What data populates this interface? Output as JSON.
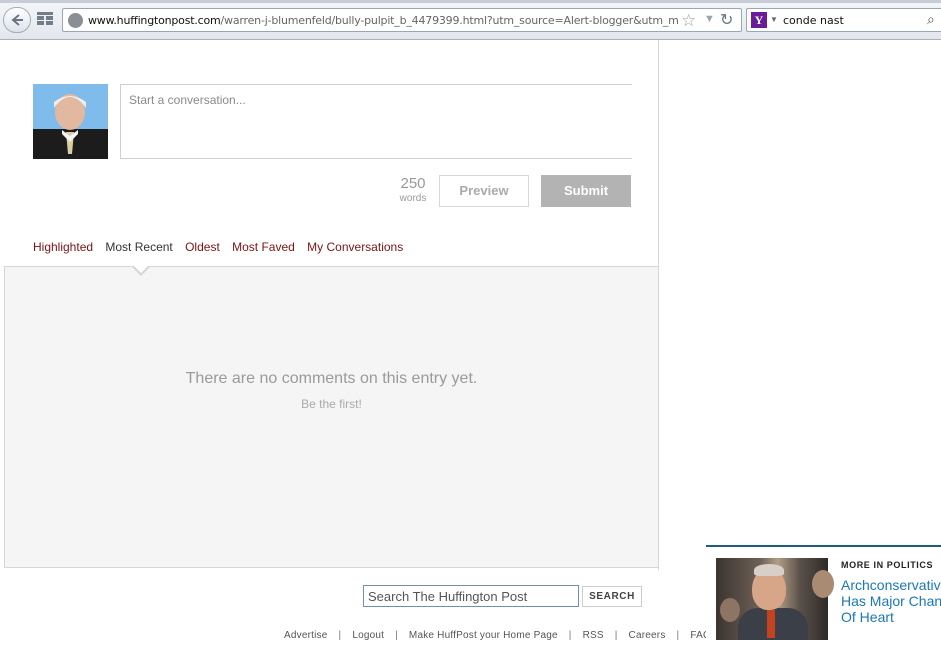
{
  "browser": {
    "url_domain": "www.huffingtonpost.com",
    "url_path": "/warren-j-blumenfeld/bully-pulpit_b_4479399.html?utm_source=Alert-blogger&utm_medium=ema",
    "search_engine_icon": "yahoo-icon",
    "search_query": "conde nast"
  },
  "composer": {
    "placeholder": "Start a conversation...",
    "word_count": "250",
    "word_unit": "words",
    "preview_label": "Preview",
    "submit_label": "Submit"
  },
  "sort_tabs": [
    {
      "label": "Highlighted",
      "active": false
    },
    {
      "label": "Most Recent",
      "active": true
    },
    {
      "label": "Oldest",
      "active": false
    },
    {
      "label": "Most Faved",
      "active": false
    },
    {
      "label": "My Conversations",
      "active": false
    }
  ],
  "comments": {
    "empty_title": "There are no comments on this entry yet.",
    "empty_sub": "Be the first!"
  },
  "site_search": {
    "placeholder": "Search The Huffington Post",
    "button_label": "SEARCH"
  },
  "footer": {
    "links": [
      "Advertise",
      "Logout",
      "Make HuffPost your Home Page",
      "RSS",
      "Careers",
      "FAQ"
    ]
  },
  "politics": {
    "kicker": "MORE IN POLITICS",
    "headline": "Archconservative Has Major Change Of Heart"
  },
  "colors": {
    "tab_link": "#7a1414",
    "headline_link": "#1a78b8",
    "submit_bg": "#b3b3b3"
  }
}
